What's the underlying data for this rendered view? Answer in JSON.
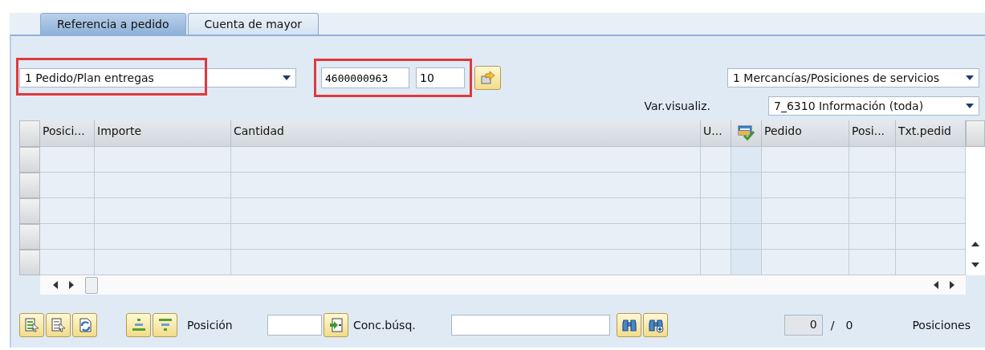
{
  "tabs": [
    {
      "label": "Referencia a pedido",
      "selected": true
    },
    {
      "label": "Cuenta de mayor",
      "selected": false
    }
  ],
  "document_type": {
    "value": "1 Pedido/Plan entregas",
    "highlighted": true
  },
  "order_reference": {
    "order": "4600000963",
    "item": "10",
    "highlighted": true
  },
  "item_type": {
    "value": "1 Mercancías/Posiciones de servicios"
  },
  "display_variant": {
    "label": "Var.visualiz.",
    "value": "7_6310 Información (toda)"
  },
  "table": {
    "columns": [
      {
        "kind": "text",
        "label": "Posici..."
      },
      {
        "kind": "text",
        "label": "Importe"
      },
      {
        "kind": "text",
        "label": "Cantidad"
      },
      {
        "kind": "text",
        "label": "U..."
      },
      {
        "kind": "icon"
      },
      {
        "kind": "text",
        "label": "Pedido"
      },
      {
        "kind": "text",
        "label": "Posi..."
      },
      {
        "kind": "text",
        "label": "Txt.pedid"
      }
    ]
  },
  "toolbar": {
    "position_label": "Posición",
    "search_label": "Conc.búsq.",
    "counter_value": "0",
    "counter_separator": "/",
    "counter_total": "0",
    "items_label": "Posiciones"
  }
}
